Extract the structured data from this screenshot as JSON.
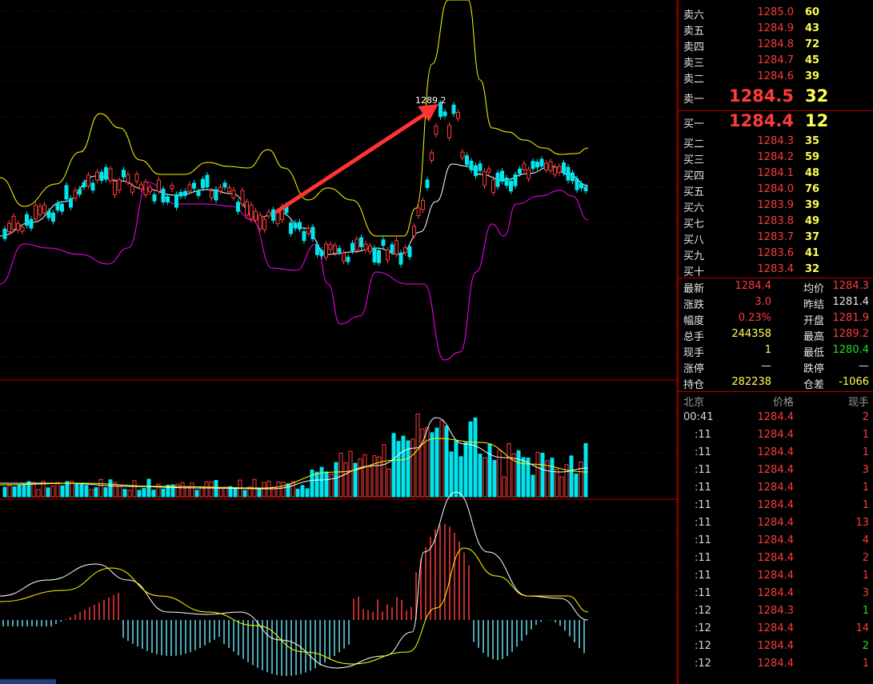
{
  "annotation": {
    "high_label": "1289.2"
  },
  "order_book": {
    "asks": [
      {
        "label": "卖六",
        "price": "1285.0",
        "vol": "60"
      },
      {
        "label": "卖五",
        "price": "1284.9",
        "vol": "43"
      },
      {
        "label": "卖四",
        "price": "1284.8",
        "vol": "72"
      },
      {
        "label": "卖三",
        "price": "1284.7",
        "vol": "45"
      },
      {
        "label": "卖二",
        "price": "1284.6",
        "vol": "39"
      }
    ],
    "ask1": {
      "label": "卖一",
      "price": "1284.5",
      "vol": "32"
    },
    "bid1": {
      "label": "买一",
      "price": "1284.4",
      "vol": "12"
    },
    "bids": [
      {
        "label": "买二",
        "price": "1284.3",
        "vol": "35"
      },
      {
        "label": "买三",
        "price": "1284.2",
        "vol": "59"
      },
      {
        "label": "买四",
        "price": "1284.1",
        "vol": "48"
      },
      {
        "label": "买五",
        "price": "1284.0",
        "vol": "76"
      },
      {
        "label": "买六",
        "price": "1283.9",
        "vol": "39"
      },
      {
        "label": "买七",
        "price": "1283.8",
        "vol": "49"
      },
      {
        "label": "买八",
        "price": "1283.7",
        "vol": "37"
      },
      {
        "label": "买九",
        "price": "1283.6",
        "vol": "41"
      },
      {
        "label": "买十",
        "price": "1283.4",
        "vol": "32"
      }
    ]
  },
  "quote": [
    {
      "l1": "最新",
      "v1": "1284.4",
      "c1": "red",
      "l2": "均价",
      "v2": "1284.3",
      "c2": "red"
    },
    {
      "l1": "涨跌",
      "v1": "3.0",
      "c1": "red",
      "l2": "昨结",
      "v2": "1281.4",
      "c2": "wht"
    },
    {
      "l1": "幅度",
      "v1": "0.23%",
      "c1": "red",
      "l2": "开盘",
      "v2": "1281.9",
      "c2": "red"
    },
    {
      "l1": "总手",
      "v1": "244358",
      "c1": "yel",
      "l2": "最高",
      "v2": "1289.2",
      "c2": "red"
    },
    {
      "l1": "现手",
      "v1": "1",
      "c1": "yel",
      "l2": "最低",
      "v2": "1280.4",
      "c2": "grn"
    },
    {
      "l1": "涨停",
      "v1": "—",
      "c1": "wht",
      "l2": "跌停",
      "v2": "—",
      "c2": "wht"
    },
    {
      "l1": "持仓",
      "v1": "282238",
      "c1": "yel",
      "l2": "仓差",
      "v2": "-1066",
      "c2": "yel"
    }
  ],
  "ticks_header": {
    "time": "北京",
    "price": "价格",
    "vol": "现手"
  },
  "ticks": [
    {
      "time": "00:41",
      "price": "1284.4",
      "vol": "2",
      "c": "red"
    },
    {
      "time": ":11",
      "price": "1284.4",
      "vol": "1",
      "c": "red"
    },
    {
      "time": ":11",
      "price": "1284.4",
      "vol": "1",
      "c": "red"
    },
    {
      "time": ":11",
      "price": "1284.4",
      "vol": "3",
      "c": "red"
    },
    {
      "time": ":11",
      "price": "1284.4",
      "vol": "1",
      "c": "red"
    },
    {
      "time": ":11",
      "price": "1284.4",
      "vol": "1",
      "c": "red"
    },
    {
      "time": ":11",
      "price": "1284.4",
      "vol": "13",
      "c": "red"
    },
    {
      "time": ":11",
      "price": "1284.4",
      "vol": "4",
      "c": "red"
    },
    {
      "time": ":11",
      "price": "1284.4",
      "vol": "2",
      "c": "red"
    },
    {
      "time": ":11",
      "price": "1284.4",
      "vol": "1",
      "c": "red"
    },
    {
      "time": ":11",
      "price": "1284.4",
      "vol": "3",
      "c": "red"
    },
    {
      "time": ":12",
      "price": "1284.3",
      "vol": "1",
      "c": "grn"
    },
    {
      "time": ":12",
      "price": "1284.4",
      "vol": "14",
      "c": "red"
    },
    {
      "time": ":12",
      "price": "1284.4",
      "vol": "2",
      "c": "grn"
    },
    {
      "time": ":12",
      "price": "1284.4",
      "vol": "1",
      "c": "red"
    }
  ],
  "colors": {
    "up": "#ff3b3b",
    "down": "#00e5ee",
    "grid": "#b00000",
    "upper_band": "#ffff00",
    "lower_band": "#ff00ff",
    "mid_line": "#ffffff"
  }
}
